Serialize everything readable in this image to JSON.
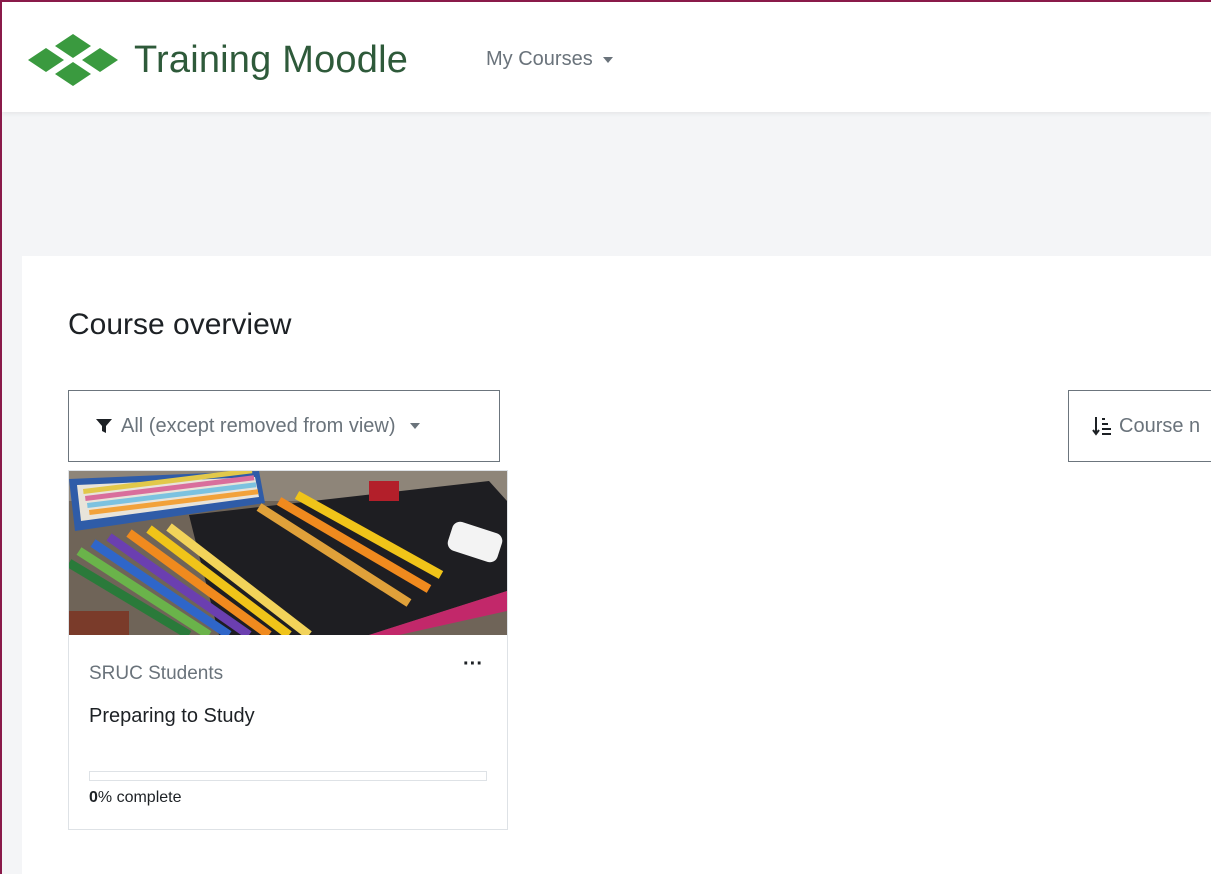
{
  "navbar": {
    "brand_name": "Training Moodle",
    "brand_color": "#2e5a3a",
    "logo_icon": "moodle-diamonds-logo",
    "my_courses_label": "My Courses"
  },
  "main": {
    "section_title": "Course overview",
    "filter_label": "All (except removed from view)",
    "filter_icon": "funnel-icon",
    "sort_label": "Course n",
    "sort_icon": "sort-descending-icon"
  },
  "course_card": {
    "category": "SRUC Students",
    "name": "Preparing to Study",
    "menu_label": "···",
    "progress_percent": "0",
    "progress_suffix": "% complete",
    "progress_fraction": 0
  }
}
